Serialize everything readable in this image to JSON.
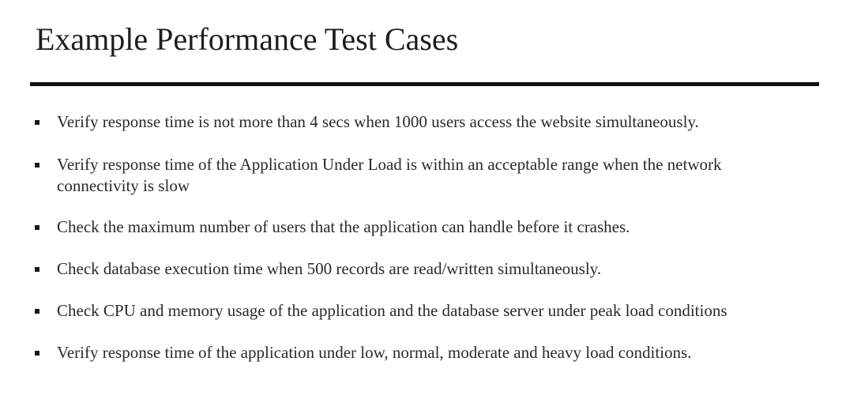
{
  "slide": {
    "title": "Example Performance Test Cases",
    "bullets": [
      {
        "text": "Verify response time is not more than 4 secs when 1000 users access the website simultaneously."
      },
      {
        "text": "Verify response time of the Application Under Load is within an acceptable range when the network connectivity is slow"
      },
      {
        "text": "Check the maximum number of users that the application can handle before it crashes."
      },
      {
        "text": "Check database execution time when 500 records are read/written simultaneously."
      },
      {
        "text": "Check CPU and memory usage of the application and the database server under peak load conditions"
      },
      {
        "text": "Verify response time of the application under low, normal, moderate and heavy load conditions."
      }
    ]
  }
}
